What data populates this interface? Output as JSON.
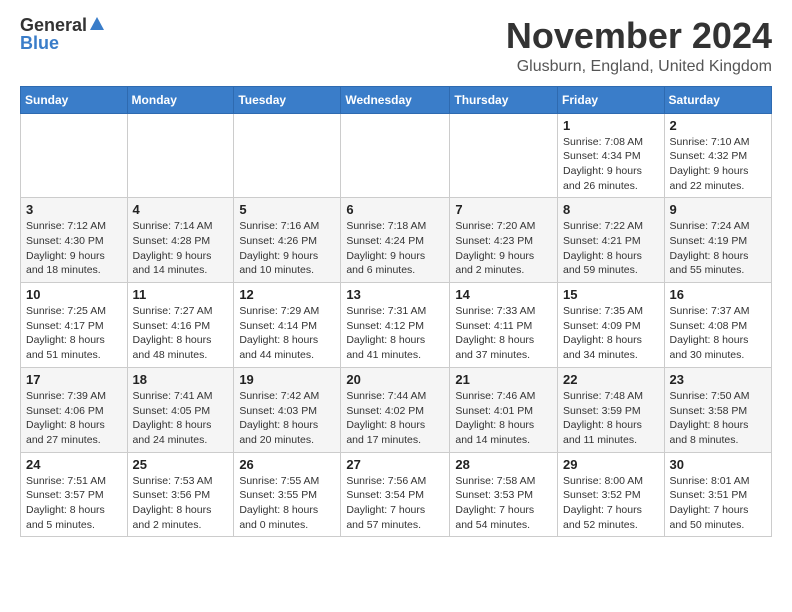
{
  "logo": {
    "general": "General",
    "blue": "Blue"
  },
  "header": {
    "month_title": "November 2024",
    "location": "Glusburn, England, United Kingdom"
  },
  "weekdays": [
    "Sunday",
    "Monday",
    "Tuesday",
    "Wednesday",
    "Thursday",
    "Friday",
    "Saturday"
  ],
  "weeks": [
    [
      {
        "day": "",
        "info": ""
      },
      {
        "day": "",
        "info": ""
      },
      {
        "day": "",
        "info": ""
      },
      {
        "day": "",
        "info": ""
      },
      {
        "day": "",
        "info": ""
      },
      {
        "day": "1",
        "info": "Sunrise: 7:08 AM\nSunset: 4:34 PM\nDaylight: 9 hours and 26 minutes."
      },
      {
        "day": "2",
        "info": "Sunrise: 7:10 AM\nSunset: 4:32 PM\nDaylight: 9 hours and 22 minutes."
      }
    ],
    [
      {
        "day": "3",
        "info": "Sunrise: 7:12 AM\nSunset: 4:30 PM\nDaylight: 9 hours and 18 minutes."
      },
      {
        "day": "4",
        "info": "Sunrise: 7:14 AM\nSunset: 4:28 PM\nDaylight: 9 hours and 14 minutes."
      },
      {
        "day": "5",
        "info": "Sunrise: 7:16 AM\nSunset: 4:26 PM\nDaylight: 9 hours and 10 minutes."
      },
      {
        "day": "6",
        "info": "Sunrise: 7:18 AM\nSunset: 4:24 PM\nDaylight: 9 hours and 6 minutes."
      },
      {
        "day": "7",
        "info": "Sunrise: 7:20 AM\nSunset: 4:23 PM\nDaylight: 9 hours and 2 minutes."
      },
      {
        "day": "8",
        "info": "Sunrise: 7:22 AM\nSunset: 4:21 PM\nDaylight: 8 hours and 59 minutes."
      },
      {
        "day": "9",
        "info": "Sunrise: 7:24 AM\nSunset: 4:19 PM\nDaylight: 8 hours and 55 minutes."
      }
    ],
    [
      {
        "day": "10",
        "info": "Sunrise: 7:25 AM\nSunset: 4:17 PM\nDaylight: 8 hours and 51 minutes."
      },
      {
        "day": "11",
        "info": "Sunrise: 7:27 AM\nSunset: 4:16 PM\nDaylight: 8 hours and 48 minutes."
      },
      {
        "day": "12",
        "info": "Sunrise: 7:29 AM\nSunset: 4:14 PM\nDaylight: 8 hours and 44 minutes."
      },
      {
        "day": "13",
        "info": "Sunrise: 7:31 AM\nSunset: 4:12 PM\nDaylight: 8 hours and 41 minutes."
      },
      {
        "day": "14",
        "info": "Sunrise: 7:33 AM\nSunset: 4:11 PM\nDaylight: 8 hours and 37 minutes."
      },
      {
        "day": "15",
        "info": "Sunrise: 7:35 AM\nSunset: 4:09 PM\nDaylight: 8 hours and 34 minutes."
      },
      {
        "day": "16",
        "info": "Sunrise: 7:37 AM\nSunset: 4:08 PM\nDaylight: 8 hours and 30 minutes."
      }
    ],
    [
      {
        "day": "17",
        "info": "Sunrise: 7:39 AM\nSunset: 4:06 PM\nDaylight: 8 hours and 27 minutes."
      },
      {
        "day": "18",
        "info": "Sunrise: 7:41 AM\nSunset: 4:05 PM\nDaylight: 8 hours and 24 minutes."
      },
      {
        "day": "19",
        "info": "Sunrise: 7:42 AM\nSunset: 4:03 PM\nDaylight: 8 hours and 20 minutes."
      },
      {
        "day": "20",
        "info": "Sunrise: 7:44 AM\nSunset: 4:02 PM\nDaylight: 8 hours and 17 minutes."
      },
      {
        "day": "21",
        "info": "Sunrise: 7:46 AM\nSunset: 4:01 PM\nDaylight: 8 hours and 14 minutes."
      },
      {
        "day": "22",
        "info": "Sunrise: 7:48 AM\nSunset: 3:59 PM\nDaylight: 8 hours and 11 minutes."
      },
      {
        "day": "23",
        "info": "Sunrise: 7:50 AM\nSunset: 3:58 PM\nDaylight: 8 hours and 8 minutes."
      }
    ],
    [
      {
        "day": "24",
        "info": "Sunrise: 7:51 AM\nSunset: 3:57 PM\nDaylight: 8 hours and 5 minutes."
      },
      {
        "day": "25",
        "info": "Sunrise: 7:53 AM\nSunset: 3:56 PM\nDaylight: 8 hours and 2 minutes."
      },
      {
        "day": "26",
        "info": "Sunrise: 7:55 AM\nSunset: 3:55 PM\nDaylight: 8 hours and 0 minutes."
      },
      {
        "day": "27",
        "info": "Sunrise: 7:56 AM\nSunset: 3:54 PM\nDaylight: 7 hours and 57 minutes."
      },
      {
        "day": "28",
        "info": "Sunrise: 7:58 AM\nSunset: 3:53 PM\nDaylight: 7 hours and 54 minutes."
      },
      {
        "day": "29",
        "info": "Sunrise: 8:00 AM\nSunset: 3:52 PM\nDaylight: 7 hours and 52 minutes."
      },
      {
        "day": "30",
        "info": "Sunrise: 8:01 AM\nSunset: 3:51 PM\nDaylight: 7 hours and 50 minutes."
      }
    ]
  ]
}
